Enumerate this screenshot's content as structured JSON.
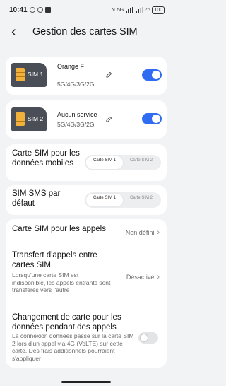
{
  "status_bar": {
    "time": "10:41",
    "battery": "100",
    "network": "5G"
  },
  "header": {
    "back_icon": "back-arrow-icon",
    "title": "Gestion des cartes SIM"
  },
  "sims": [
    {
      "badge": "SIM 1",
      "name": "Orange F",
      "network": "5G/4G/3G/2G",
      "enabled": true
    },
    {
      "badge": "SIM 2",
      "name": "Aucun service",
      "network": "5G/4G/3G/2G",
      "enabled": true
    }
  ],
  "data_sim": {
    "label": "Carte SIM pour les données mobiles",
    "options": [
      "Carte SIM 1",
      "Carte SIM 2"
    ],
    "selected": 0
  },
  "sms_sim": {
    "label": "SIM SMS par défaut",
    "options": [
      "Carte SIM 1",
      "Carte SIM 2"
    ],
    "selected": 0
  },
  "calls": {
    "label": "Carte SIM pour les appels",
    "value": "Non défini"
  },
  "forwarding": {
    "label": "Transfert d'appels entre cartes SIM",
    "description": "Lorsqu'une carte SIM est indisponible, les appels entrants sont transférés vers l'autre",
    "value": "Désactivé"
  },
  "data_switch": {
    "label": "Changement de carte pour les données pendant des appels",
    "description": "La connexion données passe sur la carte SIM 2 lors d'un appel via 4G (VoLTE) sur cette carte. Des frais additionnels pourraient s'appliquer",
    "enabled": false
  },
  "colors": {
    "accent": "#2f6cf2",
    "background": "#f1f3f5",
    "card": "#ffffff",
    "sim_chip": "#f2b13a"
  }
}
